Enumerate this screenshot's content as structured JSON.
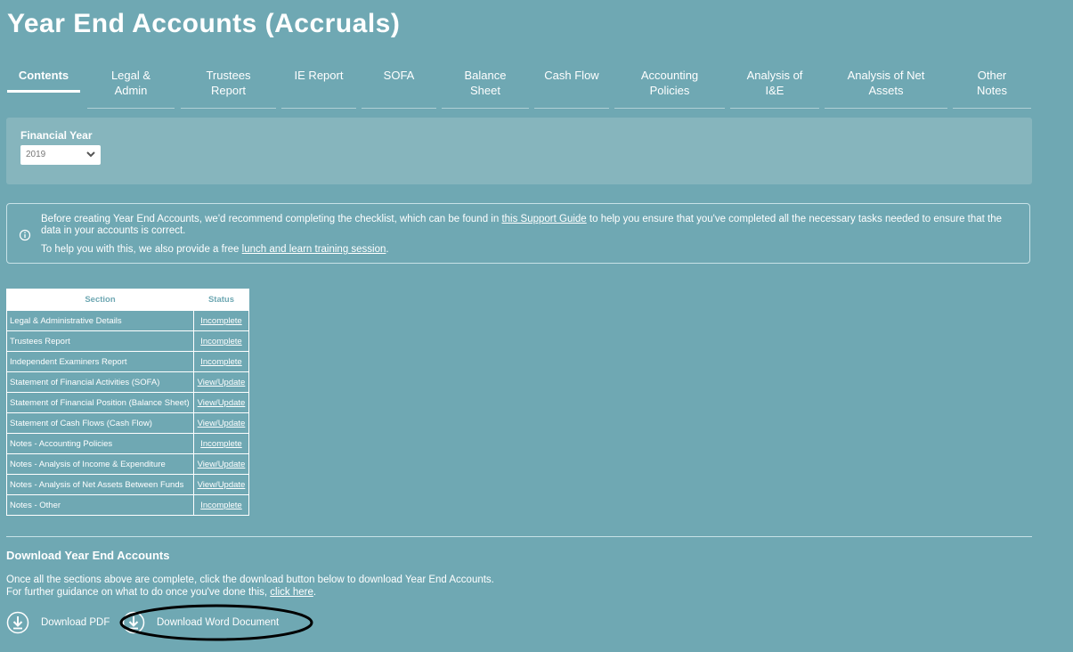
{
  "page": {
    "title": "Year End Accounts (Accruals)"
  },
  "tabs": [
    {
      "label": "Contents"
    },
    {
      "label": "Legal & Admin"
    },
    {
      "label": "Trustees Report"
    },
    {
      "label": "IE Report"
    },
    {
      "label": "SOFA"
    },
    {
      "label": "Balance Sheet"
    },
    {
      "label": "Cash Flow"
    },
    {
      "label": "Accounting Policies"
    },
    {
      "label": "Analysis of I&E"
    },
    {
      "label": "Analysis of Net Assets"
    },
    {
      "label": "Other Notes"
    }
  ],
  "financial_year": {
    "label": "Financial Year",
    "selected": "2019"
  },
  "info": {
    "line1_pre": "Before creating Year End Accounts, we'd recommend completing the checklist, which can be found in ",
    "line1_link": "this Support Guide",
    "line1_post": " to help you ensure that you've completed all the necessary tasks needed to ensure that the data in your accounts is correct.",
    "line2_pre": "To help you with this, we also provide a free ",
    "line2_link": "lunch and learn training session",
    "line2_post": "."
  },
  "table": {
    "headers": {
      "section": "Section",
      "status": "Status"
    },
    "rows": [
      {
        "section": "Legal & Administrative Details",
        "status": "Incomplete"
      },
      {
        "section": "Trustees Report",
        "status": "Incomplete"
      },
      {
        "section": "Independent Examiners Report",
        "status": "Incomplete"
      },
      {
        "section": "Statement of Financial Activities (SOFA)",
        "status": "View/Update"
      },
      {
        "section": "Statement of Financial Position (Balance Sheet)",
        "status": "View/Update"
      },
      {
        "section": "Statement of Cash Flows (Cash Flow)",
        "status": "View/Update"
      },
      {
        "section": "Notes - Accounting Policies",
        "status": "Incomplete"
      },
      {
        "section": "Notes - Analysis of Income & Expenditure",
        "status": "View/Update"
      },
      {
        "section": "Notes - Analysis of Net Assets Between Funds",
        "status": "View/Update"
      },
      {
        "section": "Notes - Other",
        "status": "Incomplete"
      }
    ]
  },
  "download": {
    "heading": "Download Year End Accounts",
    "text1": "Once all the sections above are complete, click the download button below to download Year End Accounts.",
    "text2_pre": "For further guidance on what to do once you've done this, ",
    "text2_link": "click here",
    "text2_post": ".",
    "pdf_label": "Download PDF",
    "word_label": "Download Word Document"
  }
}
